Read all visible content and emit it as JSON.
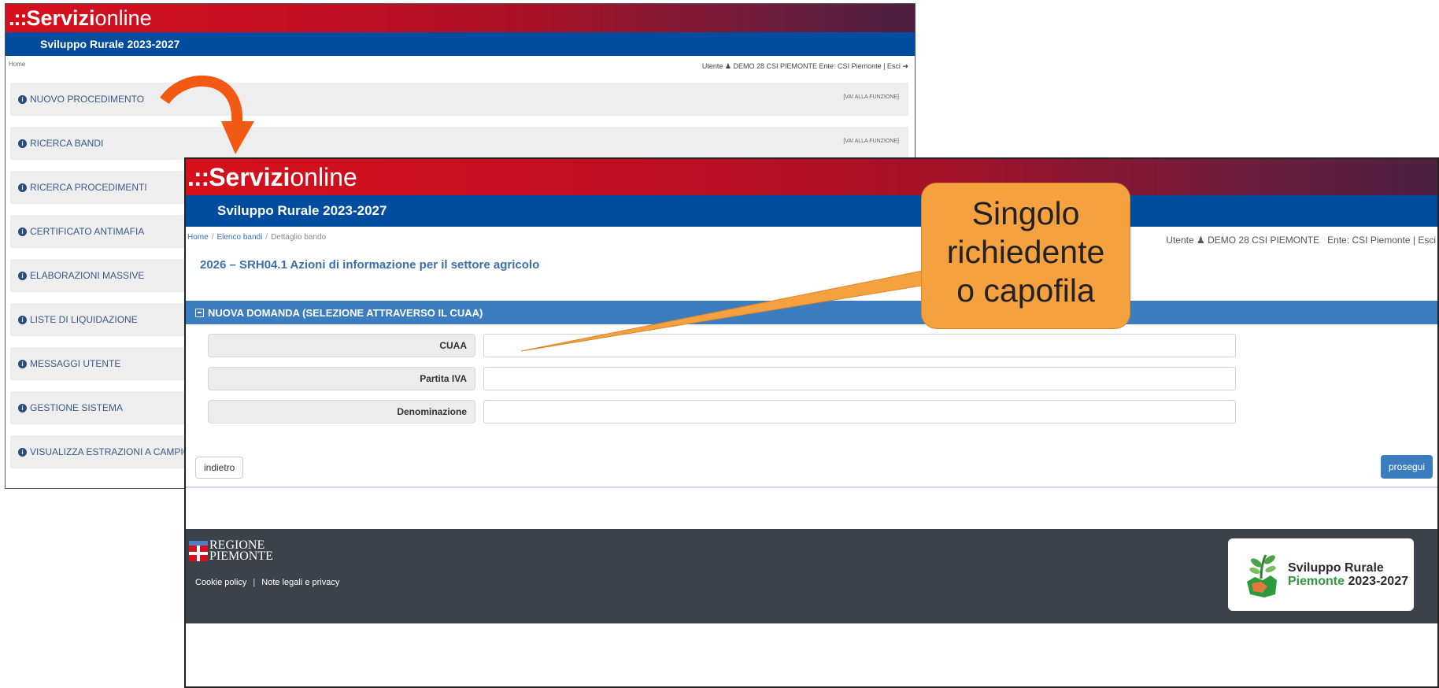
{
  "brand": {
    "strong": "Servizi",
    "light": "online",
    "dots": ".::"
  },
  "back_window": {
    "subtitle": "Sviluppo Rurale 2023-2027",
    "home": "Home",
    "user_label": "Utente",
    "user_name": "DEMO 28 CSI PIEMONTE",
    "ente": "Ente: CSI Piemonte | Esci",
    "go_label": "[VAI ALLA FUNZIONE]",
    "menu": [
      "NUOVO PROCEDIMENTO",
      "RICERCA BANDI",
      "RICERCA PROCEDIMENTI",
      "CERTIFICATO ANTIMAFIA",
      "ELABORAZIONI MASSIVE",
      "LISTE DI LIQUIDAZIONE",
      "MESSAGGI UTENTE",
      "GESTIONE SISTEMA",
      "VISUALIZZA ESTRAZIONI A CAMPIONE"
    ]
  },
  "front_window": {
    "subtitle": "Sviluppo Rurale 2023-2027",
    "breadcrumb": [
      "Home",
      "Elenco bandi",
      "Dettaglio bando"
    ],
    "user_label": "Utente",
    "user_name": "DEMO 28 CSI PIEMONTE",
    "ente": "Ente: CSI Piemonte | Esci",
    "bando_title": "2026 – SRH04.1 Azioni di informazione per il settore agricolo",
    "panel_title": "NUOVA DOMANDA (SELEZIONE ATTRAVERSO IL CUAA)",
    "fields": [
      {
        "label": "CUAA",
        "value": ""
      },
      {
        "label": "Partita IVA",
        "value": ""
      },
      {
        "label": "Denominazione",
        "value": ""
      }
    ],
    "back_button": "indietro",
    "next_button": "prosegui",
    "footer": {
      "region_line1": "REGIONE",
      "region_line2": "PIEMONTE",
      "cookie": "Cookie policy",
      "legal": "Note legali e privacy",
      "sr_line1": "Sviluppo Rurale",
      "sr_line2a": "Piemonte",
      "sr_line2b": "2023-2027"
    }
  },
  "callout": {
    "line1": "Singolo",
    "line2": "richiedente",
    "line3": "o capofila"
  },
  "colors": {
    "brand_red": "#d6101c",
    "sub_blue": "#004c9e",
    "panel_blue": "#3c7dbf",
    "callout_orange": "#f6a140",
    "arrow_orange": "#f25a14"
  }
}
